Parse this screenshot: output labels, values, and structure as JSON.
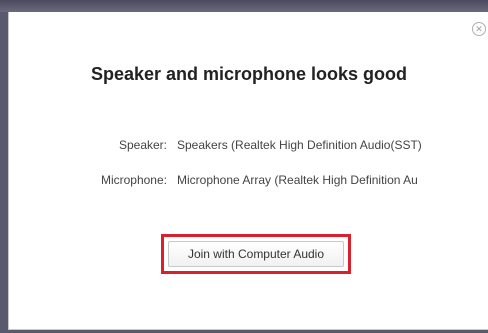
{
  "dialog": {
    "title": "Speaker and microphone looks good",
    "close_icon": "close-icon",
    "speaker": {
      "label": "Speaker:",
      "value": "Speakers (Realtek High Definition Audio(SST)"
    },
    "microphone": {
      "label": "Microphone:",
      "value": "Microphone Array (Realtek High Definition Au"
    },
    "join_button_label": "Join with Computer Audio",
    "highlight_color": "#d9202c"
  }
}
